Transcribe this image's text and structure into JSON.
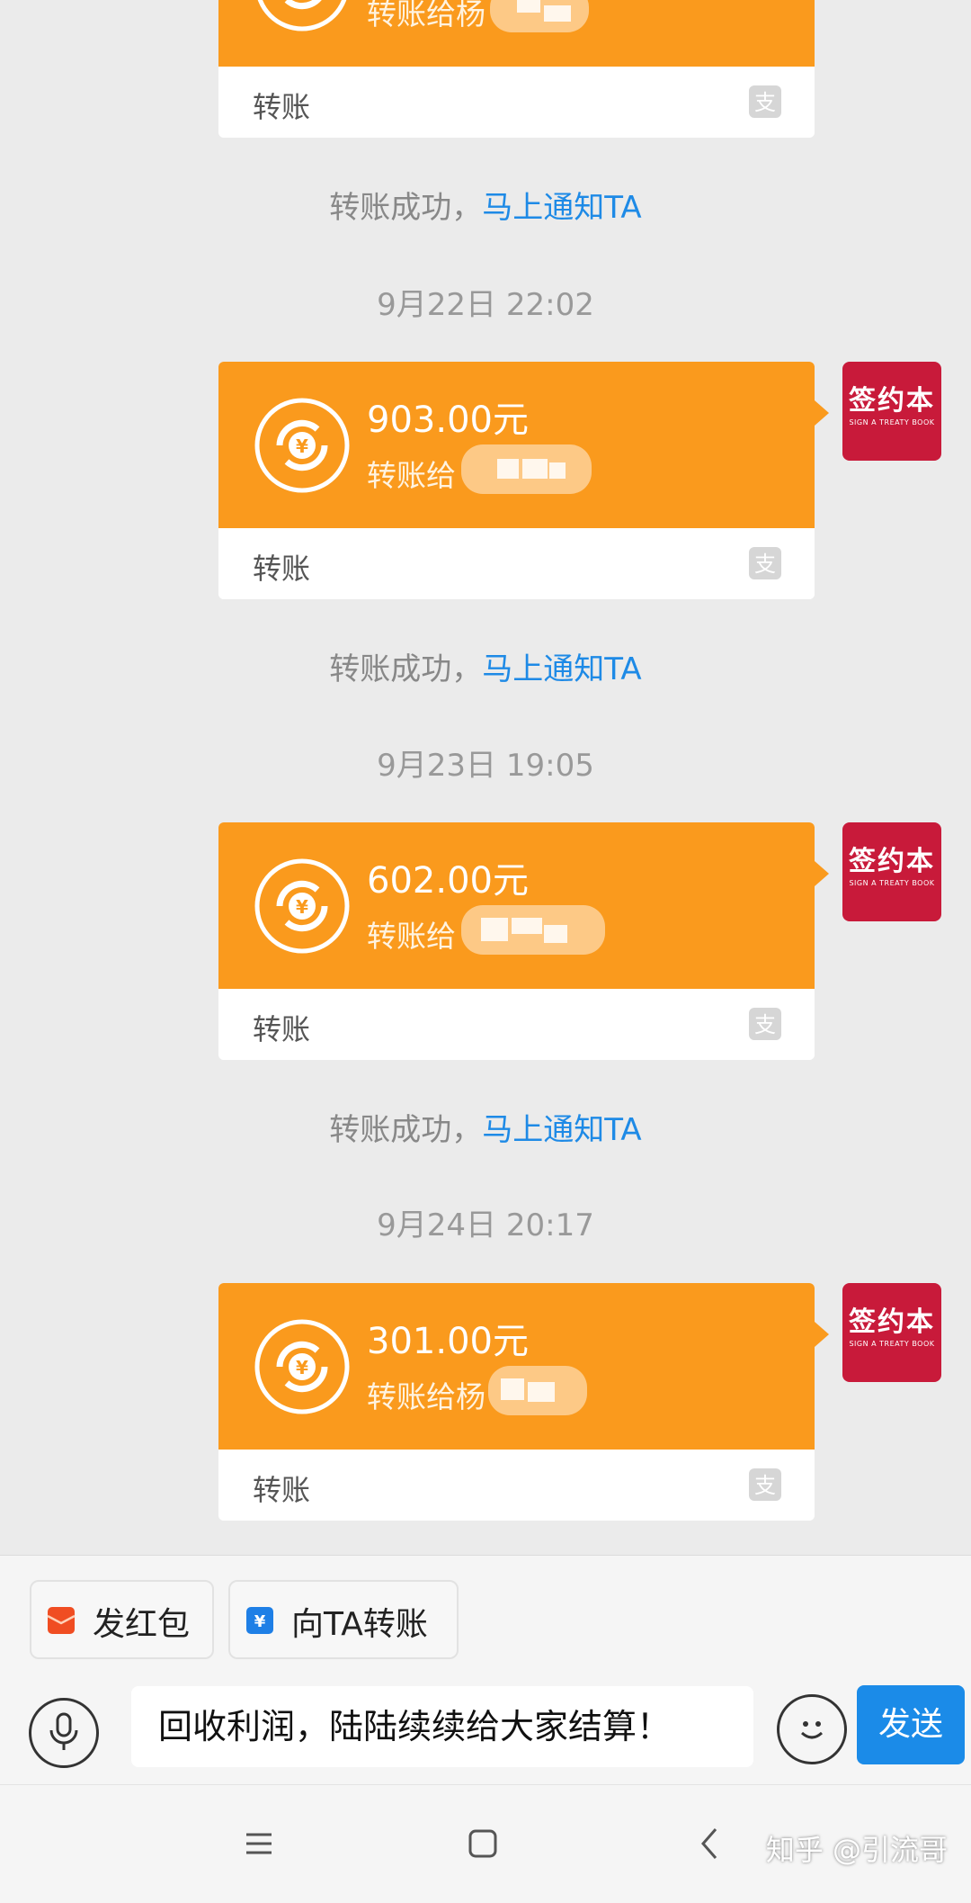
{
  "chat": {
    "partial_top_card": {
      "recipient": "转账给杨",
      "type_label": "转账"
    },
    "entries": [
      {
        "status_text": "转账成功，",
        "status_link": "马上通知TA",
        "time": "9月22日 22:02",
        "amount": "903.00元",
        "recipient": "转账给",
        "type_label": "转账"
      },
      {
        "status_text": "转账成功，",
        "status_link": "马上通知TA",
        "time": "9月23日 19:05",
        "amount": "602.00元",
        "recipient": "转账给",
        "type_label": "转账"
      },
      {
        "status_text": "转账成功，",
        "status_link": "马上通知TA",
        "time": "9月24日 20:17",
        "amount": "301.00元",
        "recipient": "转账给杨",
        "type_label": "转账"
      }
    ],
    "avatar": {
      "title": "签约本",
      "subtitle": "SIGN A TREATY BOOK"
    }
  },
  "toolbar": {
    "red_packet_label": "发红包",
    "transfer_label": "向TA转账",
    "input_value": "回收利润，陆陆续续给大家结算！",
    "send_label": "发送"
  },
  "watermark": "知乎 @引流哥",
  "colors": {
    "card_orange": "#fa9a1d",
    "link_blue": "#1e8ae6",
    "send_blue": "#1b8be8",
    "avatar_red": "#c81a3a"
  }
}
